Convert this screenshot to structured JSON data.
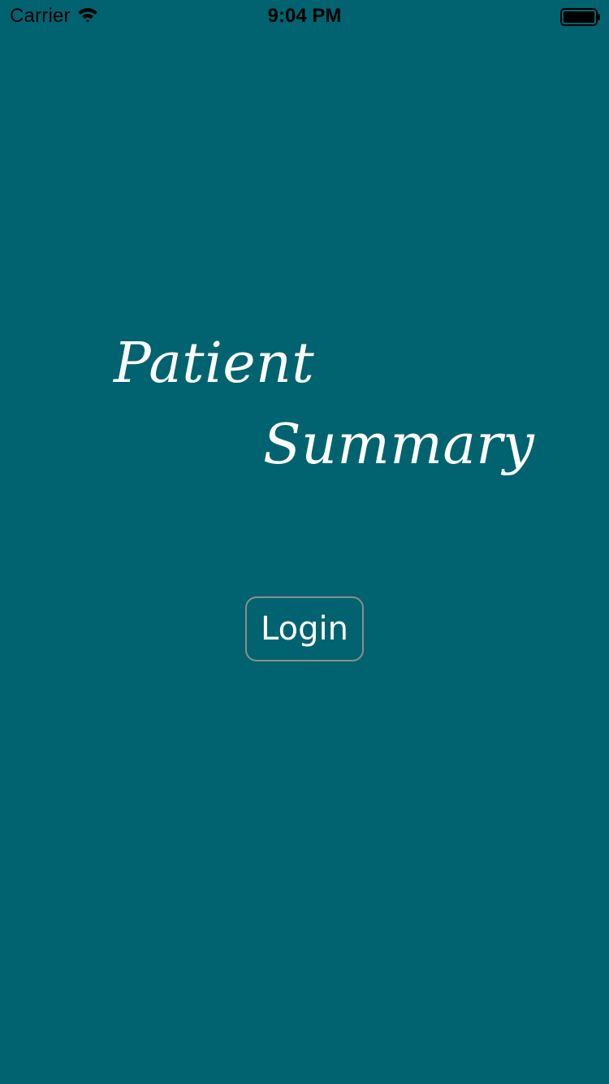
{
  "status_bar": {
    "carrier": "Carrier",
    "time": "9:04 PM",
    "icons": [
      "wifi-icon",
      "battery-icon"
    ]
  },
  "app": {
    "title_line_1": "Patient",
    "title_line_2": "Summary",
    "login_label": "Login"
  },
  "colors": {
    "background": "#01636f",
    "text": "#ffffff",
    "button_border": "#8d8d8d",
    "status_bar_text": "#000000"
  }
}
